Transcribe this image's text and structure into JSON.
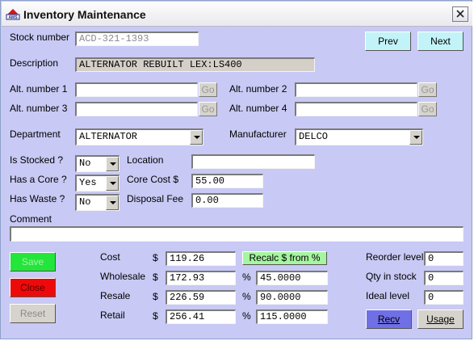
{
  "window": {
    "title": "Inventory Maintenance",
    "logo_text": "AMS"
  },
  "header": {
    "stock_label": "Stock number",
    "stock_value": "ACD-321-1393",
    "prev_label": "Prev",
    "next_label": "Next",
    "desc_label": "Description",
    "desc_value": "ALTERNATOR REBUILT LEX:LS400"
  },
  "alt": {
    "alt1_label": "Alt. number 1",
    "alt1_value": "",
    "alt2_label": "Alt. number 2",
    "alt2_value": "",
    "alt3_label": "Alt. number 3",
    "alt3_value": "",
    "alt4_label": "Alt. number 4",
    "alt4_value": "",
    "go_label": "Go"
  },
  "classification": {
    "dept_label": "Department",
    "dept_value": "ALTERNATOR",
    "mfr_label": "Manufacturer",
    "mfr_value": "DELCO"
  },
  "flags": {
    "stocked_label": "Is Stocked ?",
    "stocked_value": "No",
    "core_label": "Has a Core ?",
    "core_value": "Yes",
    "waste_label": "Has Waste ?",
    "waste_value": "No",
    "location_label": "Location",
    "location_value": "",
    "corecost_label": "Core Cost $",
    "corecost_value": "55.00",
    "disposal_label": "Disposal Fee",
    "disposal_value": "0.00"
  },
  "comment": {
    "label": "Comment",
    "value": ""
  },
  "actions": {
    "save_label": "Save",
    "close_label": "Close",
    "reset_label": "Reset",
    "recv_label": "Recv",
    "usage_label": "Usage"
  },
  "pricing": {
    "dollar": "$",
    "percent": "%",
    "cost_label": "Cost",
    "cost_value": "119.26",
    "recalc_label": "Recalc $ from %",
    "wholesale_label": "Wholesale",
    "wholesale_value": "172.93",
    "wholesale_pct": "45.0000",
    "resale_label": "Resale",
    "resale_value": "226.59",
    "resale_pct": "90.0000",
    "retail_label": "Retail",
    "retail_value": "256.41",
    "retail_pct": "115.0000"
  },
  "stock": {
    "reorder_label": "Reorder level",
    "reorder_value": "0",
    "qty_label": "Qty in stock",
    "qty_value": "0",
    "ideal_label": "Ideal level",
    "ideal_value": "0"
  },
  "colors": {
    "background": "#c8c9f4",
    "nav_button": "#c2f3f8",
    "save_button": "#22e63a",
    "close_button": "#ee0a0a",
    "recalc_button": "#a6f5a0",
    "recv_button": "#6f6fe6"
  }
}
